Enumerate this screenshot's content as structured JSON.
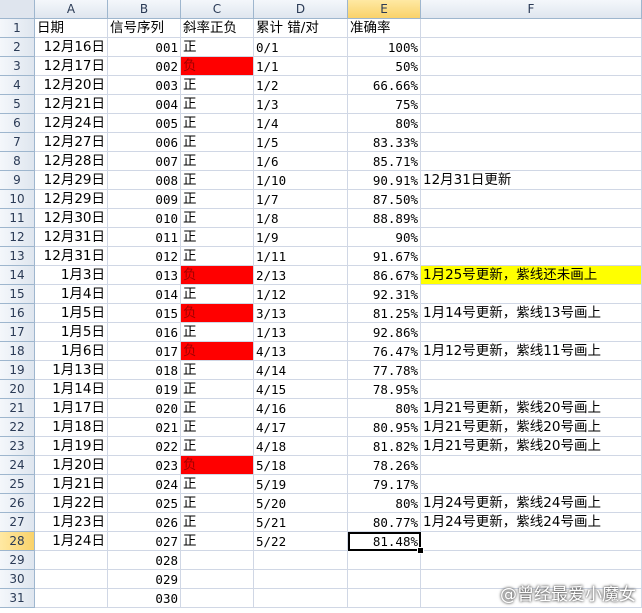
{
  "columns": [
    "A",
    "B",
    "C",
    "D",
    "E",
    "F"
  ],
  "active_column": "E",
  "active_row": 28,
  "header_row": [
    "日期",
    "信号序列",
    "斜率正负",
    "累计 错/对",
    "准确率",
    ""
  ],
  "rows": [
    {
      "date": "12月16日",
      "seq": "001",
      "sign": "正",
      "cum": "0/1",
      "acc": "100%",
      "note": ""
    },
    {
      "date": "12月17日",
      "seq": "002",
      "sign": "负",
      "cum": "1/1",
      "acc": "50%",
      "note": ""
    },
    {
      "date": "12月20日",
      "seq": "003",
      "sign": "正",
      "cum": "1/2",
      "acc": "66.66%",
      "note": ""
    },
    {
      "date": "12月21日",
      "seq": "004",
      "sign": "正",
      "cum": "1/3",
      "acc": "75%",
      "note": ""
    },
    {
      "date": "12月24日",
      "seq": "005",
      "sign": "正",
      "cum": "1/4",
      "acc": "80%",
      "note": ""
    },
    {
      "date": "12月27日",
      "seq": "006",
      "sign": "正",
      "cum": "1/5",
      "acc": "83.33%",
      "note": ""
    },
    {
      "date": "12月28日",
      "seq": "007",
      "sign": "正",
      "cum": "1/6",
      "acc": "85.71%",
      "note": ""
    },
    {
      "date": "12月29日",
      "seq": "008",
      "sign": "正",
      "cum": "1/10",
      "acc": "90.91%",
      "note": "12月31日更新"
    },
    {
      "date": "12月29日",
      "seq": "009",
      "sign": "正",
      "cum": "1/7",
      "acc": "87.50%",
      "note": ""
    },
    {
      "date": "12月30日",
      "seq": "010",
      "sign": "正",
      "cum": "1/8",
      "acc": "88.89%",
      "note": ""
    },
    {
      "date": "12月31日",
      "seq": "011",
      "sign": "正",
      "cum": "1/9",
      "acc": "90%",
      "note": ""
    },
    {
      "date": "12月31日",
      "seq": "012",
      "sign": "正",
      "cum": "1/11",
      "acc": "91.67%",
      "note": ""
    },
    {
      "date": "1月3日",
      "seq": "013",
      "sign": "负",
      "cum": "2/13",
      "acc": "86.67%",
      "note": "1月25号更新，紫线还未画上",
      "highlight": true
    },
    {
      "date": "1月4日",
      "seq": "014",
      "sign": "正",
      "cum": "1/12",
      "acc": "92.31%",
      "note": ""
    },
    {
      "date": "1月5日",
      "seq": "015",
      "sign": "负",
      "cum": "3/13",
      "acc": "81.25%",
      "note": "1月14号更新，紫线13号画上"
    },
    {
      "date": "1月5日",
      "seq": "016",
      "sign": "正",
      "cum": "1/13",
      "acc": "92.86%",
      "note": ""
    },
    {
      "date": "1月6日",
      "seq": "017",
      "sign": "负",
      "cum": "4/13",
      "acc": "76.47%",
      "note": "1月12号更新，紫线11号画上"
    },
    {
      "date": "1月13日",
      "seq": "018",
      "sign": "正",
      "cum": "4/14",
      "acc": "77.78%",
      "note": ""
    },
    {
      "date": "1月14日",
      "seq": "019",
      "sign": "正",
      "cum": "4/15",
      "acc": "78.95%",
      "note": ""
    },
    {
      "date": "1月17日",
      "seq": "020",
      "sign": "正",
      "cum": "4/16",
      "acc": "80%",
      "note": "1月21号更新，紫线20号画上"
    },
    {
      "date": "1月18日",
      "seq": "021",
      "sign": "正",
      "cum": "4/17",
      "acc": "80.95%",
      "note": "1月21号更新，紫线20号画上"
    },
    {
      "date": "1月19日",
      "seq": "022",
      "sign": "正",
      "cum": "4/18",
      "acc": "81.82%",
      "note": "1月21号更新，紫线20号画上"
    },
    {
      "date": "1月20日",
      "seq": "023",
      "sign": "负",
      "cum": "5/18",
      "acc": "78.26%",
      "note": ""
    },
    {
      "date": "1月21日",
      "seq": "024",
      "sign": "正",
      "cum": "5/19",
      "acc": "79.17%",
      "note": ""
    },
    {
      "date": "1月22日",
      "seq": "025",
      "sign": "正",
      "cum": "5/20",
      "acc": "80%",
      "note": "1月24号更新，紫线24号画上"
    },
    {
      "date": "1月23日",
      "seq": "026",
      "sign": "正",
      "cum": "5/21",
      "acc": "80.77%",
      "note": "1月24号更新，紫线24号画上"
    },
    {
      "date": "1月24日",
      "seq": "027",
      "sign": "正",
      "cum": "5/22",
      "acc": "81.48%",
      "note": "",
      "selected": true
    },
    {
      "date": "",
      "seq": "028",
      "sign": "",
      "cum": "",
      "acc": "",
      "note": ""
    },
    {
      "date": "",
      "seq": "029",
      "sign": "",
      "cum": "",
      "acc": "",
      "note": ""
    },
    {
      "date": "",
      "seq": "030",
      "sign": "",
      "cum": "",
      "acc": "",
      "note": ""
    }
  ],
  "colors": {
    "negative": "#ff0000",
    "highlight": "#ffff00"
  },
  "watermark": "@曾经最爱小魔女"
}
